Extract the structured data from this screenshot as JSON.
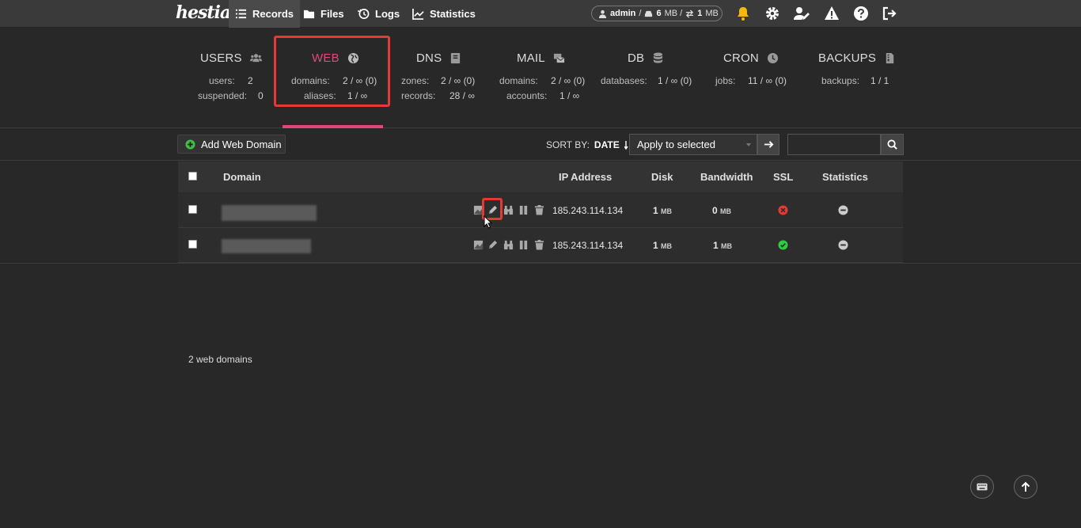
{
  "topbar": {
    "logo": "hestia",
    "nav": [
      {
        "label": "Records",
        "icon": "list-icon",
        "active": true
      },
      {
        "label": "Files",
        "icon": "folder-icon"
      },
      {
        "label": "Logs",
        "icon": "history-icon"
      },
      {
        "label": "Statistics",
        "icon": "chart-icon"
      }
    ],
    "user": "admin",
    "disk_value": "6",
    "disk_unit": "MB /",
    "bw_value": "1",
    "bw_unit": "MB"
  },
  "stats": {
    "users": {
      "title": "USERS",
      "rows": [
        {
          "label": "users:",
          "value": "2"
        },
        {
          "label": "suspended:",
          "value": "0"
        }
      ]
    },
    "web": {
      "title": "WEB",
      "rows": [
        {
          "label": "domains:",
          "value": "2 / ∞ (0)"
        },
        {
          "label": "aliases:",
          "value": "1 / ∞"
        }
      ]
    },
    "dns": {
      "title": "DNS",
      "rows": [
        {
          "label": "zones:",
          "value": "2 / ∞ (0)"
        },
        {
          "label": "records:",
          "value": "28 / ∞"
        }
      ]
    },
    "mail": {
      "title": "MAIL",
      "rows": [
        {
          "label": "domains:",
          "value": "2 / ∞ (0)"
        },
        {
          "label": "accounts:",
          "value": "1 / ∞"
        }
      ]
    },
    "db": {
      "title": "DB",
      "rows": [
        {
          "label": "databases:",
          "value": "1 / ∞ (0)"
        }
      ]
    },
    "cron": {
      "title": "CRON",
      "rows": [
        {
          "label": "jobs:",
          "value": "11 / ∞ (0)"
        }
      ]
    },
    "backups": {
      "title": "BACKUPS",
      "rows": [
        {
          "label": "backups:",
          "value": "1 / 1"
        }
      ]
    }
  },
  "toolbar": {
    "add_label": "Add Web Domain",
    "sort_label": "SORT BY:",
    "sort_value": "DATE",
    "apply_selected": "Apply to selected",
    "search_placeholder": ""
  },
  "table": {
    "headers": {
      "domain": "Domain",
      "ip": "IP Address",
      "disk": "Disk",
      "bandwidth": "Bandwidth",
      "ssl": "SSL",
      "statistics": "Statistics"
    },
    "rows": [
      {
        "ip": "185.243.114.134",
        "disk": "1",
        "disk_unit": "MB",
        "bandwidth": "0",
        "bw_unit": "MB",
        "ssl": "disabled",
        "stats": "disabled"
      },
      {
        "ip": "185.243.114.134",
        "disk": "1",
        "disk_unit": "MB",
        "bandwidth": "1",
        "bw_unit": "MB",
        "ssl": "enabled",
        "stats": "disabled"
      }
    ]
  },
  "footer": {
    "count": "2 web domains"
  },
  "colors": {
    "accent": "#e3477a",
    "highlight": "#e53935",
    "ok": "#2ecc40",
    "error": "#e53935"
  }
}
